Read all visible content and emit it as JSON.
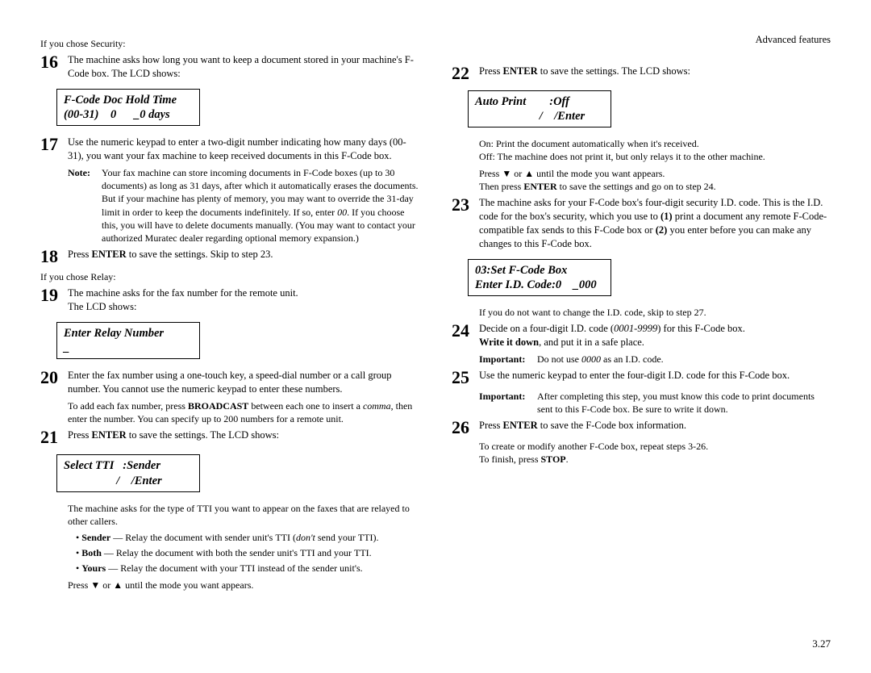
{
  "header": {
    "section": "Advanced features"
  },
  "page_number": "3.27",
  "col1": {
    "security_intro": "If you chose Security:",
    "step16": {
      "num": "16",
      "text_a": "The machine asks how long you want to keep a document stored in your machine's F-Code box. The ",
      "text_b": " shows:"
    },
    "lcd_holdtime_l1": "F-Code Doc Hold Time",
    "lcd_holdtime_l2": "(00-31)    0      _0 days",
    "step17": {
      "num": "17",
      "text": "Use the numeric keypad to enter a two-digit number indicating how many days (00-31), you want your fax machine to keep received documents in this F-Code box."
    },
    "note17_label": "Note:",
    "note17_body_a": "Your fax machine can store incoming documents in F-Code boxes (up to 30 documents) as long as 31 days, after which it automatically erases the documents. But if your machine has plenty of memory, you may want to override the 31-day limit in order to keep the documents indefinitely. If so, enter ",
    "note17_body_em": "00",
    "note17_body_b": ". If you choose this, you will have to delete documents manually. (You may want to contact your authorized Muratec dealer regarding optional memory expansion.)",
    "step18": {
      "num": "18",
      "pre": "Press ",
      "key": "ENTER",
      "post": " to save the settings. Skip to step 23."
    },
    "relay_intro": "If you chose Relay:",
    "step19": {
      "num": "19",
      "text_a": "The machine asks for the fax number for the remote unit.",
      "text_b": "The ",
      "text_c": " shows:"
    },
    "lcd_relay_l1": "Enter Relay Number",
    "lcd_relay_l2": "_",
    "step20": {
      "num": "20",
      "text": "Enter the fax number using a one-touch key, a speed-dial number or a call group number. You cannot use the numeric keypad to enter these numbers."
    },
    "step20_sub_a": "To add each fax number, press ",
    "step20_sub_key": "BROADCAST",
    "step20_sub_b": " between each one to insert a ",
    "step20_sub_em": "comma",
    "step20_sub_c": ", then enter the number. You can specify up to 200 numbers for a remote unit.",
    "step21": {
      "num": "21",
      "pre": "Press ",
      "key": "ENTER",
      "post_a": " to save the settings. The ",
      "post_b": " shows:"
    },
    "lcd_tti_l1": "Select TTI   :Sender",
    "lcd_tti_l2": "                  /    /Enter",
    "step21_sub_a": "The machine asks for the type of ",
    "step21_sub_b": " you want to appear on the faxes that are relayed to other callers.",
    "bullet_sender_a": "Sender",
    "bullet_sender_b": " — Relay the document with sender unit's ",
    "bullet_sender_c": " (",
    "bullet_sender_em": "don't",
    "bullet_sender_d": " send your ",
    "bullet_sender_e": ").",
    "bullet_both_a": "Both",
    "bullet_both_b": " — Relay the document with both the sender unit's ",
    "bullet_both_c": " and your ",
    "bullet_both_d": ".",
    "bullet_yours_a": "Yours",
    "bullet_yours_b": " — Relay the document with your ",
    "bullet_yours_c": " instead of the sender unit's.",
    "press_arrows": "Press ▼ or ▲ until the mode you want appears."
  },
  "col2": {
    "step22": {
      "num": "22",
      "pre": "Press ",
      "key": "ENTER",
      "post_a": " to save the settings. The ",
      "post_b": " shows:"
    },
    "lcd_auto_l1": "Auto Print        :Off",
    "lcd_auto_l2": "                      /    /Enter",
    "onoff_on": "On:   Print the document automatically when it's received.",
    "onoff_off": "Off:  The machine does not print it, but only relays it to the other machine.",
    "press_arrows2": "Press ▼ or ▲ until the mode you want appears.",
    "then_press_a": "Then press ",
    "then_press_key": "ENTER",
    "then_press_b": " to save the settings and go on to step 24.",
    "step23": {
      "num": "23",
      "text_a": "The machine asks for your F-Code box's four-digit security ",
      "text_b": " code. This is the ",
      "text_c": " code for the box's security, which you use to ",
      "bold1": "(1)",
      "text_d": " print a document any remote F-Code-compatible fax sends to this F-Code box or ",
      "bold2": "(2)",
      "text_e": " you enter before you can make any changes to this F-Code box."
    },
    "lcd_id_l1": "03:Set F-Code Box",
    "lcd_id_l2": "Enter I.D. Code:0    _000",
    "step23_sub_a": "If you do not want to change the ",
    "step23_sub_b": " code, skip to step 27.",
    "step24": {
      "num": "24",
      "text_a": "Decide on a four-digit ",
      "text_b": " code (",
      "em": "0001-9999",
      "text_c": ") for this F-Code box.",
      "bold_line": "Write it down",
      "text_d": ", and put it in a safe place."
    },
    "imp24_label": "Important:",
    "imp24_a": "Do not use ",
    "imp24_em": "0000",
    "imp24_b": " as an ",
    "imp24_c": " code.",
    "step25": {
      "num": "25",
      "text_a": "Use the numeric keypad to enter the four-digit ",
      "text_b": " code for this F-Code box."
    },
    "imp25_label": "Important:",
    "imp25_text": "After completing this step, you must know this code to print documents sent to this F-Code box. Be sure to write it down.",
    "step26": {
      "num": "26",
      "pre": "Press ",
      "key": "ENTER",
      "post": " to save the F-Code box information."
    },
    "step26_sub1": "To create or modify another F-Code box, repeat steps 3-26.",
    "step26_sub2_a": "To finish, press ",
    "step26_sub2_key": "STOP",
    "step26_sub2_b": "."
  },
  "labels": {
    "lcd": "LCD",
    "tti": "TTI",
    "id": "I.D."
  }
}
